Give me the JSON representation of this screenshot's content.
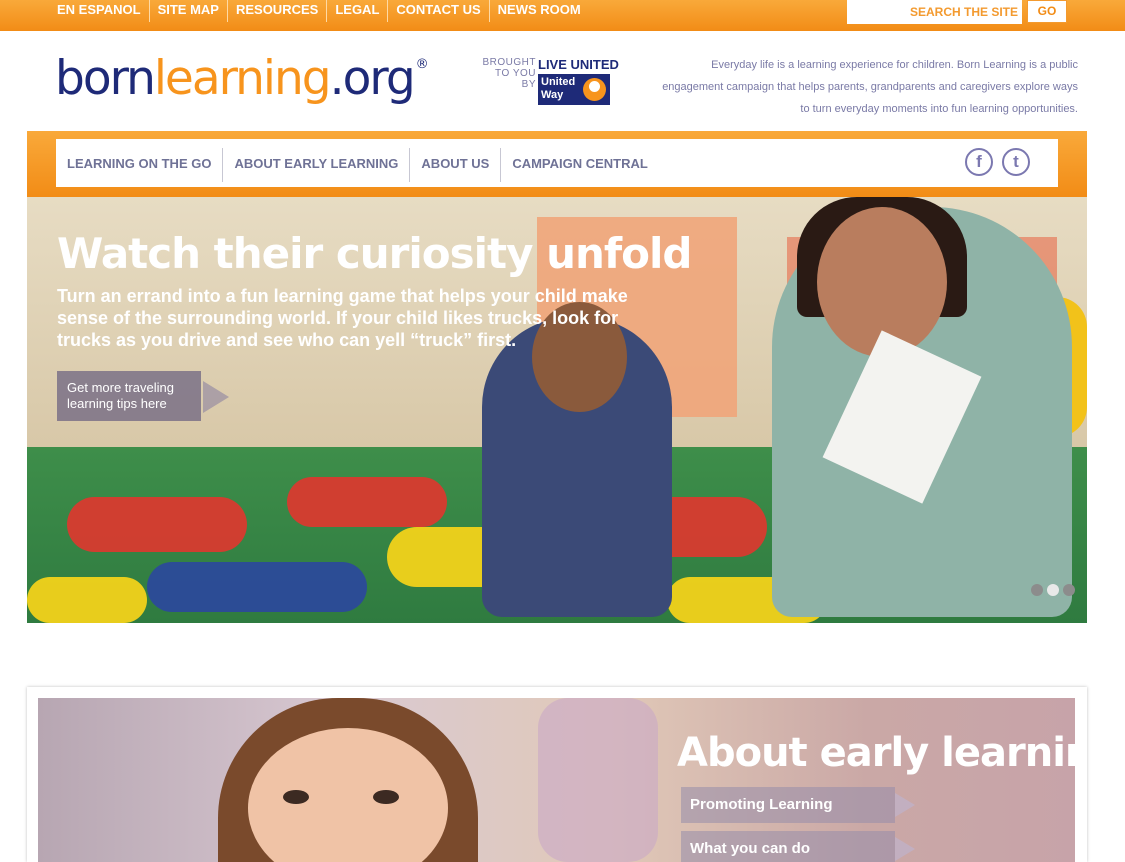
{
  "top_links": [
    "EN ESPANOL",
    "SITE MAP",
    "RESOURCES",
    "LEGAL",
    "CONTACT US",
    "NEWS ROOM"
  ],
  "search": {
    "placeholder": "SEARCH THE SITE",
    "go_label": "GO"
  },
  "logo": {
    "born": "born",
    "learning": "learning",
    "org": ".org",
    "registered": "®"
  },
  "sponsor": {
    "brought_line1": "BROUGHT",
    "brought_line2": "TO YOU",
    "brought_line3": "BY",
    "live_united": "LIVE UNITED",
    "united": "United",
    "way": "Way"
  },
  "tagline": "Everyday life is a learning experience for children. Born Learning is a public engagement campaign that helps parents, grandparents and caregivers explore ways to turn everyday moments into fun learning opportunities.",
  "nav": [
    "LEARNING ON THE GO",
    "ABOUT EARLY LEARNING",
    "ABOUT US",
    "CAMPAIGN CENTRAL"
  ],
  "social": {
    "facebook_glyph": "f",
    "twitter_glyph": "t"
  },
  "hero": {
    "title": "Watch their curiosity unfold",
    "text": "Turn an errand into a fun learning game that helps your child make sense of the surrounding world. If your child likes trucks, look for trucks as you drive and see who can yell “truck” first.",
    "cta": "Get more traveling learning tips here",
    "slides": 3,
    "active_slide": 2
  },
  "early_learning": {
    "title": "About early learning",
    "links": [
      "Promoting Learning",
      "What you can do"
    ]
  },
  "colors": {
    "orange": "#f7941d",
    "navy": "#1e2a78",
    "nav_text": "#6f7296"
  }
}
